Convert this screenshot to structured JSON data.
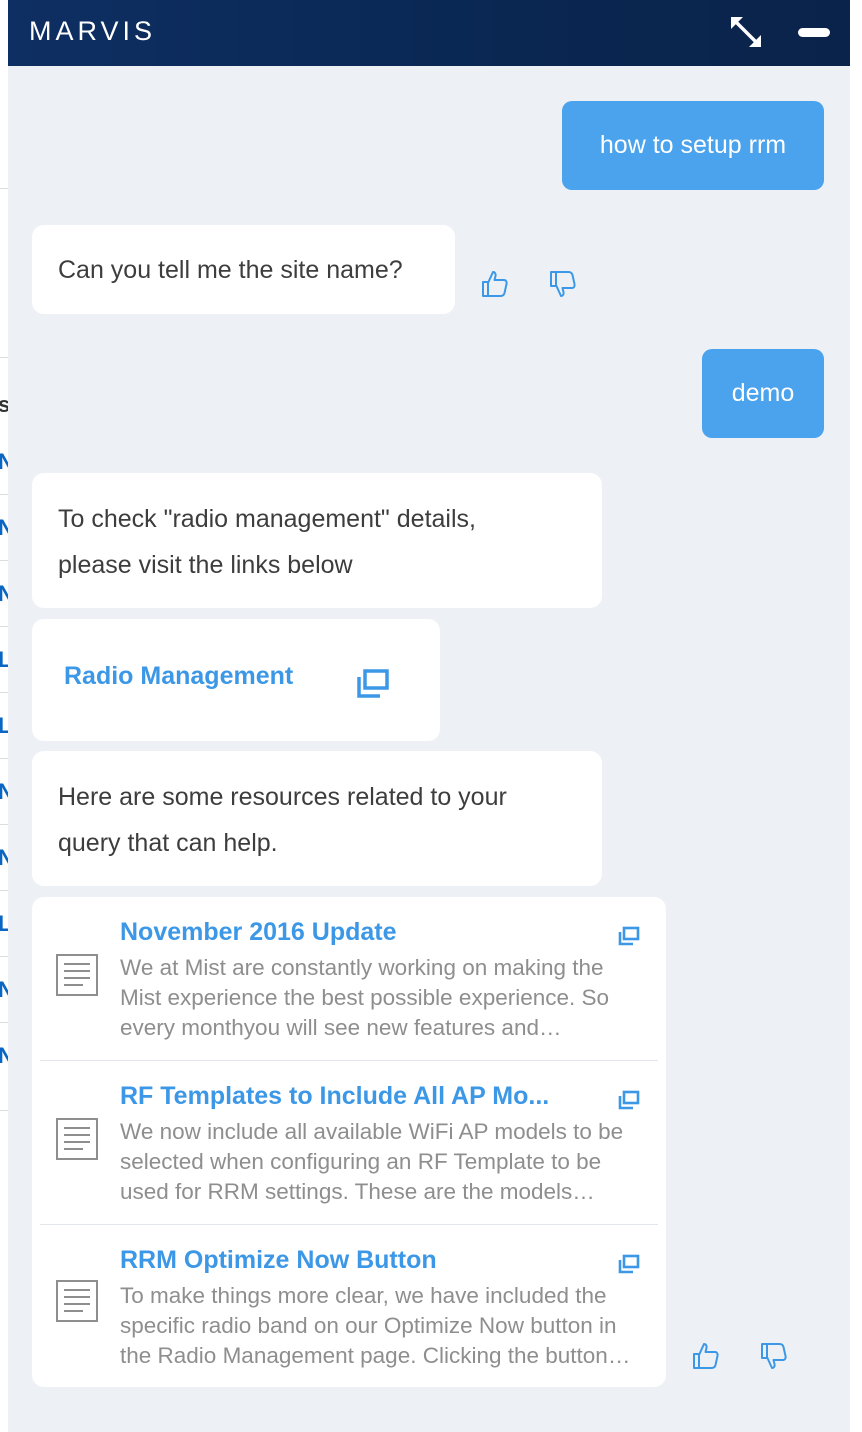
{
  "header": {
    "title": "MARVIS"
  },
  "messages": {
    "user_1": "how to setup rrm",
    "bot_1": "Can you tell me the site name?",
    "user_2": "demo",
    "bot_2_line1": "To check \"radio management\" details,",
    "bot_2_line2": "please visit the links below",
    "bot_3_line1": "Here are some resources related to your",
    "bot_3_line2": "query that can help."
  },
  "link_card": {
    "label": "Radio Management"
  },
  "resources": [
    {
      "title": "November 2016 Update",
      "description": "We at Mist are constantly working on making the Mist experience the best possible experience. So every monthyou will see new features and improvements."
    },
    {
      "title": "RF Templates to Include All AP Mo...",
      "description": "We now include all available WiFi AP models to be selected when configuring an RF Template to be used for RRM settings. These are the models supported."
    },
    {
      "title": "RRM Optimize Now Button",
      "description": "To make things more clear, we have included the specific radio band on our Optimize Now button in the Radio Management page. Clicking the button now starts."
    }
  ],
  "background_app": {
    "letters": [
      "s",
      "N",
      "N",
      "N",
      "L",
      "L",
      "N",
      "N",
      "L",
      "N",
      "N"
    ]
  },
  "icons": {
    "expand": "expand-icon",
    "minimize": "minimize-icon",
    "thumbs_up": "thumbs-up-icon",
    "thumbs_down": "thumbs-down-icon",
    "open_external": "open-in-new-window-icon",
    "document": "document-icon"
  },
  "colors": {
    "header": "#0e2f63",
    "user_bubble": "#4aa3ec",
    "link": "#3c98e6",
    "panel_background": "#edf1f5"
  }
}
